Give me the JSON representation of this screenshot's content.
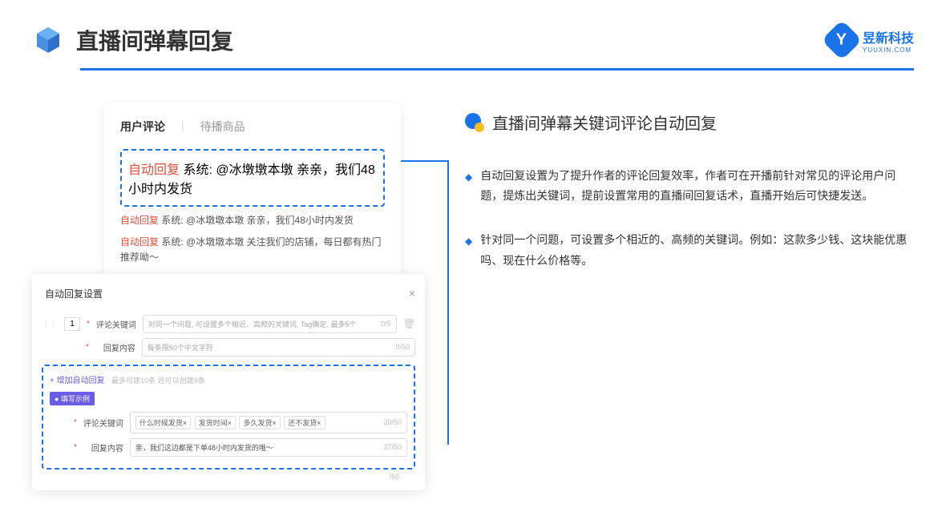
{
  "header": {
    "title": "直播间弹幕回复",
    "brand_name": "昱新科技",
    "brand_sub": "YUUXIN.COM"
  },
  "card1": {
    "tab1": "用户评论",
    "tab2": "待播商品",
    "highlight_tag": "自动回复",
    "highlight_text": " 系统: @冰墩墩本墩 亲亲，我们48小时内发货",
    "row2_tag": "自动回复",
    "row2_text": " 系统: @冰墩墩本墩 亲亲，我们48小时内发货",
    "row3_tag": "自动回复",
    "row3_text": " 系统: @冰墩墩本墩 关注我们的店铺，每日都有热门推荐呦～"
  },
  "card2": {
    "modal_title": "自动回复设置",
    "row_num": "1",
    "label1": "评论关键词",
    "placeholder1": "对同一个问题, 可设置多个相近、高频的关键词, Tag确定, 最多5个",
    "counter1": "0/5",
    "label2": "回复内容",
    "placeholder2": "每条限50个中文字符",
    "counter2": "0/50",
    "add_link": "+ 增加自动回复",
    "add_hint": "最多可建10条 还可以创建9条",
    "example_badge": "● 填写示例",
    "ex_label1": "评论关键词",
    "tag1": "什么时候发货×",
    "tag2": "发货时间×",
    "tag3": "多久发货×",
    "tag4": "还不发货×",
    "ex_counter1": "20/50",
    "ex_label2": "回复内容",
    "ex_value2": "亲，我们这边都是下单48小时内发货的哦～",
    "ex_counter2": "37/50",
    "outer_counter": "/50"
  },
  "right": {
    "subtitle": "直播间弹幕关键词评论自动回复",
    "bullet1": "自动回复设置为了提升作者的评论回复效率，作者可在开播前针对常见的评论用户问题，提炼出关键词，提前设置常用的直播间回复话术，直播开始后可快捷发送。",
    "bullet2": "针对同一个问题，可设置多个相近的、高频的关键词。例如：这款多少钱、这块能优惠吗、现在什么价格等。"
  }
}
